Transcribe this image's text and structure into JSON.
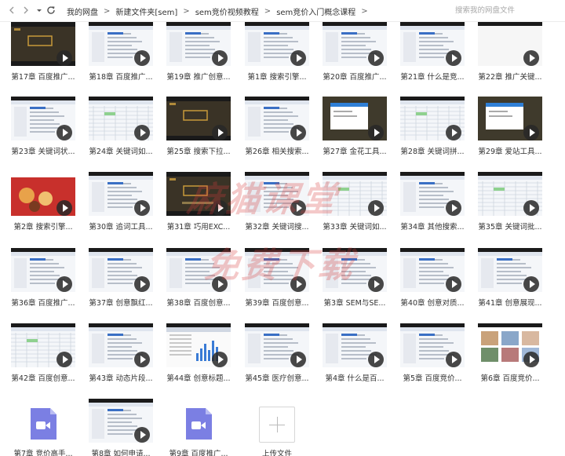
{
  "toolbar": {
    "back_icon": "chevron-left-icon",
    "forward_icon": "chevron-right-icon",
    "history_icon": "dropdown-caret-icon",
    "refresh_icon": "refresh-icon"
  },
  "breadcrumb": [
    "我的网盘",
    "新建文件夹[sem]",
    "sem竞价视频教程",
    "sem竞价入门概念课程"
  ],
  "search": {
    "placeholder": "搜索我的网盘文件"
  },
  "watermark": [
    "麻猫课堂",
    "免费下载"
  ],
  "files": [
    {
      "name": "第17章 百度推广...",
      "thumb": "dark"
    },
    {
      "name": "第18章 百度推广...",
      "thumb": "screen"
    },
    {
      "name": "第19章 推广创意...",
      "thumb": "screen"
    },
    {
      "name": "第1章 搜索引擎...",
      "thumb": "screen"
    },
    {
      "name": "第20章 百度推广...",
      "thumb": "screen"
    },
    {
      "name": "第21章 什么是竞...",
      "thumb": "screen"
    },
    {
      "name": "第22章 推广关键...",
      "thumb": "white"
    },
    {
      "name": "第23章 关键词状...",
      "thumb": "screen"
    },
    {
      "name": "第24章 关键词如...",
      "thumb": "sheet"
    },
    {
      "name": "第25章 搜索下拉...",
      "thumb": "dark"
    },
    {
      "name": "第26章 相关搜索...",
      "thumb": "screen"
    },
    {
      "name": "第27章 金花工具...",
      "thumb": "darkwin"
    },
    {
      "name": "第28章 关键词拼...",
      "thumb": "sheet"
    },
    {
      "name": "第29章 爱站工具...",
      "thumb": "darkwin"
    },
    {
      "name": "第2章 搜索引擎...",
      "thumb": "red"
    },
    {
      "name": "第30章 追词工具...",
      "thumb": "screen"
    },
    {
      "name": "第31章 巧用EXC...",
      "thumb": "darkbar"
    },
    {
      "name": "第32章 关键词搜...",
      "thumb": "screen"
    },
    {
      "name": "第33章 关键词如...",
      "thumb": "sheet"
    },
    {
      "name": "第34章 其他搜索...",
      "thumb": "screen"
    },
    {
      "name": "第35章 关键词批...",
      "thumb": "sheet"
    },
    {
      "name": "第36章 百度推广...",
      "thumb": "screen"
    },
    {
      "name": "第37章 创意飘红...",
      "thumb": "screen"
    },
    {
      "name": "第38章 百度创意...",
      "thumb": "screen"
    },
    {
      "name": "第39章 百度创意...",
      "thumb": "screen"
    },
    {
      "name": "第3章 SEM与SE...",
      "thumb": "screen"
    },
    {
      "name": "第40章 创意对质...",
      "thumb": "screen"
    },
    {
      "name": "第41章 创意展现...",
      "thumb": "screen"
    },
    {
      "name": "第42章 百度创意...",
      "thumb": "sheet"
    },
    {
      "name": "第43章 动态片段...",
      "thumb": "screen"
    },
    {
      "name": "第44章 创意标题...",
      "thumb": "chart"
    },
    {
      "name": "第45章 医疗创意...",
      "thumb": "screen"
    },
    {
      "name": "第4章 什么是百...",
      "thumb": "screen"
    },
    {
      "name": "第5章 百度竞价...",
      "thumb": "screen"
    },
    {
      "name": "第6章 百度竞价...",
      "thumb": "photo"
    },
    {
      "name": "第7章 竞价高手...",
      "thumb": "videoicon"
    },
    {
      "name": "第8章 如何申请...",
      "thumb": "screen"
    },
    {
      "name": "第9章 百度推广...",
      "thumb": "videoicon"
    },
    {
      "name": "上传文件",
      "thumb": "upload"
    }
  ],
  "colors": {
    "video_icon": "#7b7fe3",
    "watermark": "#d63c3c",
    "dark_thumb": "#3a3326",
    "sem_text": "#c89a3a"
  }
}
